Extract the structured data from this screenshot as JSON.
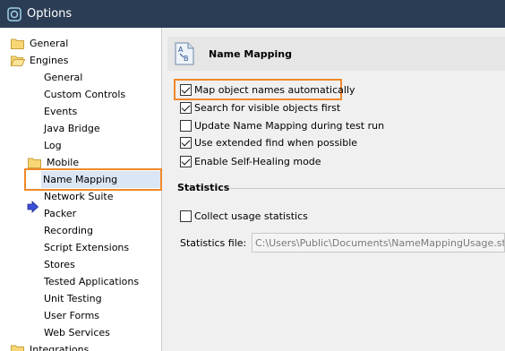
{
  "window": {
    "title": "Options"
  },
  "tree": {
    "items": [
      {
        "label": "General"
      },
      {
        "label": "Engines"
      },
      {
        "label": "General"
      },
      {
        "label": "Custom Controls"
      },
      {
        "label": "Events"
      },
      {
        "label": "Java Bridge"
      },
      {
        "label": "Log"
      },
      {
        "label": "Mobile"
      },
      {
        "label": "Name Mapping"
      },
      {
        "label": "Network Suite"
      },
      {
        "label": "Packer"
      },
      {
        "label": "Recording"
      },
      {
        "label": "Script Extensions"
      },
      {
        "label": "Stores"
      },
      {
        "label": "Tested Applications"
      },
      {
        "label": "Unit Testing"
      },
      {
        "label": "User Forms"
      },
      {
        "label": "Web Services"
      },
      {
        "label": "Integrations"
      }
    ]
  },
  "page": {
    "title": "Name Mapping",
    "icon_letters": [
      "A",
      "B"
    ],
    "options": [
      {
        "label": "Map object names automatically",
        "checked": true
      },
      {
        "label": "Search for visible objects first",
        "checked": true
      },
      {
        "label": "Update Name Mapping during test run",
        "checked": false
      },
      {
        "label": "Use extended find when possible",
        "checked": true
      },
      {
        "label": "Enable Self-Healing mode",
        "checked": true
      }
    ],
    "statistics": {
      "heading": "Statistics",
      "collect_label": "Collect usage statistics",
      "collect_checked": false,
      "file_label": "Statistics file:",
      "file_value": "C:\\Users\\Public\\Documents\\NameMappingUsage.stat"
    }
  },
  "colors": {
    "titlebar": "#2b3d55",
    "highlight": "#f0892b"
  }
}
